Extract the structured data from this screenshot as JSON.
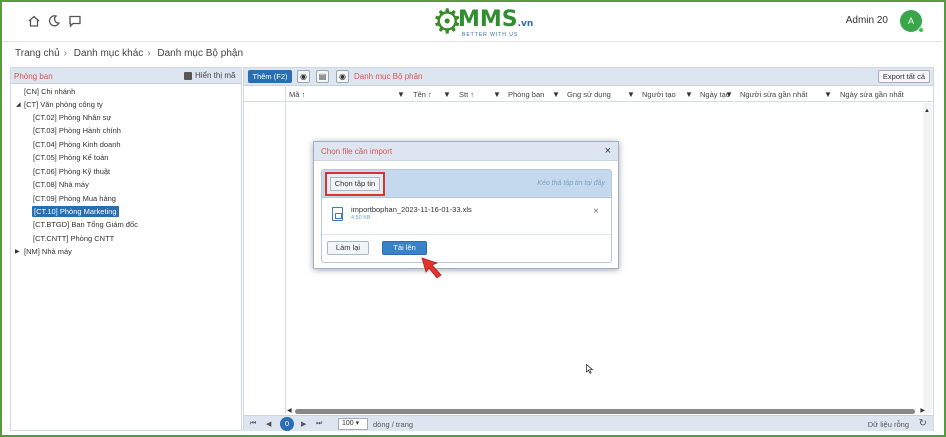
{
  "header": {
    "logo_main": "MMS",
    "logo_suffix": ".vn",
    "logo_tagline": "BETTER WITH US",
    "user_name": "Admin 20",
    "avatar_initial": "A"
  },
  "breadcrumb": [
    "Trang chủ",
    "Danh mục khác",
    "Danh mục Bộ phận"
  ],
  "left_panel": {
    "title": "Phòng ban",
    "show_code_label": "Hiển thị mã",
    "tree": [
      {
        "label": "[CN] Chi nhánh"
      },
      {
        "label": "[CT] Văn phòng công ty"
      },
      {
        "label": "[CT.02] Phòng Nhân sự"
      },
      {
        "label": "[CT.03] Phòng Hành chính"
      },
      {
        "label": "[CT.04] Phòng Kinh doanh"
      },
      {
        "label": "[CT.05] Phòng Kế toán"
      },
      {
        "label": "[CT.06] Phòng Kỹ thuật"
      },
      {
        "label": "[CT.08] Nhà máy"
      },
      {
        "label": "[CT.09] Phòng Mua hàng"
      },
      {
        "label": "[CT.10] Phòng Marketing"
      },
      {
        "label": "[CT.BTGD] Ban Tổng Giám đốc"
      },
      {
        "label": "[CT.CNTT] Phòng CNTT"
      },
      {
        "label": "[NM] Nhà máy"
      }
    ]
  },
  "toolbar": {
    "add_label": "Thêm (F2)",
    "title": "Danh mục Bộ phận",
    "export_label": "Export tất cả"
  },
  "columns": [
    "Mã ↑",
    "Tên ↑",
    "Stt ↑",
    "Phòng ban",
    "Gng sử dụng",
    "Người tạo",
    "Ngày tạo",
    "Người sửa gần nhất",
    "Ngày sửa gần nhất"
  ],
  "pager": {
    "current_page": "0",
    "page_size": "100",
    "page_size_label": "dòng / trang",
    "empty_label": "Dữ liệu rỗng"
  },
  "modal": {
    "title": "Chọn file cần import",
    "choose_label": "Chọn tập tin",
    "drop_hint": "Kéo thả tập tin tại đây",
    "file_name": "importbophan_2023-11-16-01-33.xls",
    "file_size": "4.50 KB",
    "reset_label": "Làm lại",
    "upload_label": "Tải lên"
  }
}
